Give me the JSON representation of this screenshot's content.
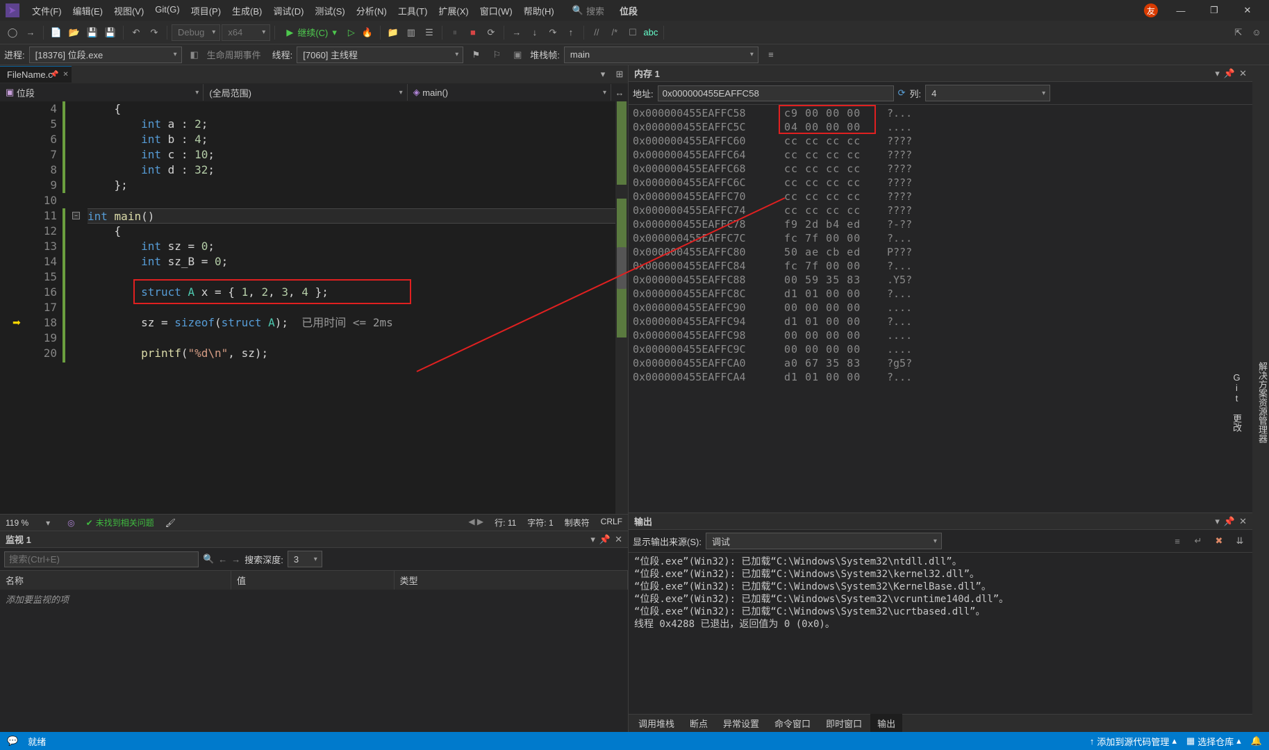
{
  "menubar": {
    "items": [
      "文件(F)",
      "编辑(E)",
      "视图(V)",
      "Git(G)",
      "项目(P)",
      "生成(B)",
      "调试(D)",
      "测试(S)",
      "分析(N)",
      "工具(T)",
      "扩展(X)",
      "窗口(W)",
      "帮助(H)"
    ],
    "search_placeholder": "搜索",
    "app_title": "位段"
  },
  "toolbar": {
    "config": "Debug",
    "platform": "x64",
    "continue_label": "继续(C)"
  },
  "debugbar": {
    "process_label": "进程:",
    "process_value": "[18376] 位段.exe",
    "lifecycle_label": "生命周期事件",
    "thread_label": "线程:",
    "thread_value": "[7060] 主线程",
    "stackframe_label": "堆栈帧:",
    "stackframe_value": "main"
  },
  "editor": {
    "tab_name": "FileName.c*",
    "nav_project": "位段",
    "nav_scope": "(全局范围)",
    "nav_symbol": "main()",
    "zoom": "119 %",
    "issues_ok": "未找到相关问题",
    "pos_line": "行: 11",
    "pos_char": "字符: 1",
    "tabs_mode": "制表符",
    "line_end": "CRLF",
    "lines": [
      {
        "n": 4,
        "txt": "{",
        "indent": 1
      },
      {
        "n": 5,
        "txt": "int a : 2;",
        "indent": 2,
        "ty": true
      },
      {
        "n": 6,
        "txt": "int b : 4;",
        "indent": 2,
        "ty": true
      },
      {
        "n": 7,
        "txt": "int c : 10;",
        "indent": 2,
        "ty": true
      },
      {
        "n": 8,
        "txt": "int d : 32;",
        "indent": 2,
        "ty": true
      },
      {
        "n": 9,
        "txt": "};",
        "indent": 1
      },
      {
        "n": 10,
        "txt": "",
        "indent": 0
      },
      {
        "n": 11,
        "txt": "int main()",
        "indent": 0,
        "active": true,
        "fold": true
      },
      {
        "n": 12,
        "txt": "{",
        "indent": 1
      },
      {
        "n": 13,
        "txt": "int sz = 0;",
        "indent": 2,
        "ty": true
      },
      {
        "n": 14,
        "txt": "int sz_B = 0;",
        "indent": 2,
        "ty": true
      },
      {
        "n": 15,
        "txt": "",
        "indent": 2
      },
      {
        "n": 16,
        "txt": "struct A x = { 1, 2, 3, 4 };",
        "indent": 2,
        "struct": true
      },
      {
        "n": 17,
        "txt": "",
        "indent": 2
      },
      {
        "n": 18,
        "txt": "sz = sizeof(struct A);  已用时间 <= 2ms",
        "indent": 2,
        "sizeof": true,
        "arrow": true
      },
      {
        "n": 19,
        "txt": "",
        "indent": 2
      },
      {
        "n": 20,
        "txt": "printf(\"%d\\n\", sz);",
        "indent": 2,
        "printf": true
      }
    ]
  },
  "memory": {
    "title": "内存 1",
    "addr_label": "地址:",
    "addr_value": "0x000000455EAFFC58",
    "cols_label": "列:",
    "cols_value": "4",
    "rows": [
      {
        "addr": "0x000000455EAFFC58",
        "hex": "c9 00 00 00",
        "ascii": "?..."
      },
      {
        "addr": "0x000000455EAFFC5C",
        "hex": "04 00 00 00",
        "ascii": "...."
      },
      {
        "addr": "0x000000455EAFFC60",
        "hex": "cc cc cc cc",
        "ascii": "????"
      },
      {
        "addr": "0x000000455EAFFC64",
        "hex": "cc cc cc cc",
        "ascii": "????"
      },
      {
        "addr": "0x000000455EAFFC68",
        "hex": "cc cc cc cc",
        "ascii": "????"
      },
      {
        "addr": "0x000000455EAFFC6C",
        "hex": "cc cc cc cc",
        "ascii": "????"
      },
      {
        "addr": "0x000000455EAFFC70",
        "hex": "cc cc cc cc",
        "ascii": "????"
      },
      {
        "addr": "0x000000455EAFFC74",
        "hex": "cc cc cc cc",
        "ascii": "????"
      },
      {
        "addr": "0x000000455EAFFC78",
        "hex": "f9 2d b4 ed",
        "ascii": "?-??"
      },
      {
        "addr": "0x000000455EAFFC7C",
        "hex": "fc 7f 00 00",
        "ascii": "?..."
      },
      {
        "addr": "0x000000455EAFFC80",
        "hex": "50 ae cb ed",
        "ascii": "P???"
      },
      {
        "addr": "0x000000455EAFFC84",
        "hex": "fc 7f 00 00",
        "ascii": "?..."
      },
      {
        "addr": "0x000000455EAFFC88",
        "hex": "00 59 35 83",
        "ascii": ".Y5?"
      },
      {
        "addr": "0x000000455EAFFC8C",
        "hex": "d1 01 00 00",
        "ascii": "?..."
      },
      {
        "addr": "0x000000455EAFFC90",
        "hex": "00 00 00 00",
        "ascii": "...."
      },
      {
        "addr": "0x000000455EAFFC94",
        "hex": "d1 01 00 00",
        "ascii": "?..."
      },
      {
        "addr": "0x000000455EAFFC98",
        "hex": "00 00 00 00",
        "ascii": "...."
      },
      {
        "addr": "0x000000455EAFFC9C",
        "hex": "00 00 00 00",
        "ascii": "...."
      },
      {
        "addr": "0x000000455EAFFCA0",
        "hex": "a0 67 35 83",
        "ascii": "?g5?"
      },
      {
        "addr": "0x000000455EAFFCA4",
        "hex": "d1 01 00 00",
        "ascii": "?..."
      }
    ]
  },
  "watch": {
    "title": "监视 1",
    "search_placeholder": "搜索(Ctrl+E)",
    "depth_label": "搜索深度:",
    "depth_value": "3",
    "cols": [
      "名称",
      "值",
      "类型"
    ],
    "add_prompt": "添加要监视的项"
  },
  "output": {
    "title": "输出",
    "source_label": "显示输出来源(S):",
    "source_value": "调试",
    "lines": [
      "“位段.exe”(Win32): 已加载“C:\\Windows\\System32\\ntdll.dll”。",
      "“位段.exe”(Win32): 已加载“C:\\Windows\\System32\\kernel32.dll”。",
      "“位段.exe”(Win32): 已加载“C:\\Windows\\System32\\KernelBase.dll”。",
      "“位段.exe”(Win32): 已加载“C:\\Windows\\System32\\vcruntime140d.dll”。",
      "“位段.exe”(Win32): 已加载“C:\\Windows\\System32\\ucrtbased.dll”。",
      "线程 0x4288 已退出，返回值为 0 (0x0)。"
    ]
  },
  "bottom_tabs_right": [
    "调用堆栈",
    "断点",
    "异常设置",
    "命令窗口",
    "即时窗口",
    "输出"
  ],
  "right_side_tabs": [
    "解决方案资源管理器",
    "Git 更改"
  ],
  "footer": {
    "ready": "就绪",
    "source_ctrl": "添加到源代码管理",
    "repo": "选择仓库"
  }
}
